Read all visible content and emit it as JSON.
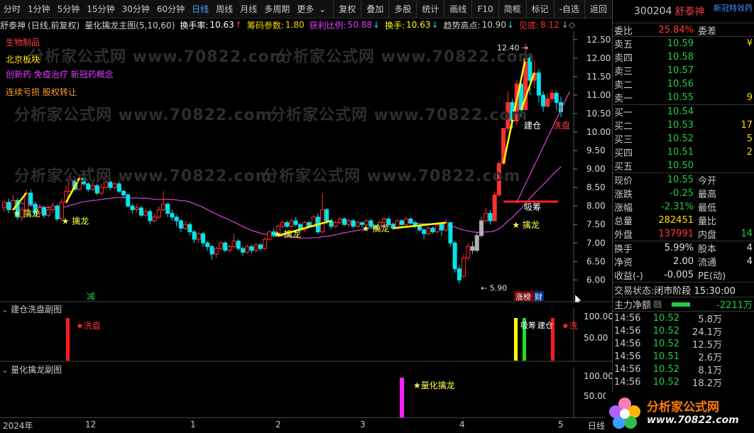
{
  "toolbar": {
    "periods": [
      "分时",
      "1分钟",
      "5分钟",
      "15分钟",
      "30分钟",
      "60分钟",
      "日线",
      "周线",
      "月线",
      "多周期",
      "更多"
    ],
    "active_period": "日线",
    "buttons": [
      "复权",
      "叠加",
      "多股",
      "统计",
      "画线",
      "F10",
      "简框",
      "标记",
      "-自选",
      "返回"
    ]
  },
  "info_line": {
    "stock": "舒泰神",
    "mode": "(日线,前复权)",
    "indicator": "量化擒龙主图(5,10,60)",
    "turnover_label": "换手率:",
    "turnover_value": "10.63",
    "chip_label": "筹码参数:",
    "chip_value": "1.80",
    "profit_label": "获利比例:",
    "profit_value": "50.88",
    "hand_label": "换手:",
    "hand_value": "10.63",
    "trend_label": "趋势高点:",
    "trend_value": "10.90",
    "bottom_label": "见底:",
    "bottom_value": "8.12"
  },
  "concepts": [
    {
      "text": "生物制品",
      "color": "#ff4040"
    },
    {
      "text": "北京板块",
      "color": "#ffe000"
    },
    {
      "text": "创新药 免疫治疗 新冠药概念",
      "color": "#e040ff"
    },
    {
      "text": "连续亏损 股权转让",
      "color": "#ff9a30"
    }
  ],
  "watermark": "分析家公式网 www.70822.com",
  "chart_data": {
    "type": "candlestick",
    "price_axis": [
      "12.50",
      "12.00",
      "11.50",
      "11.00",
      "10.50",
      "10.00",
      "9.50",
      "9.00",
      "8.50",
      "8.00",
      "7.50",
      "7.00",
      "6.50",
      "6.00"
    ],
    "ylim": [
      5.7,
      12.65
    ],
    "high_label": "12.40",
    "low_label": "5.90",
    "x_ticks": [
      "2024年",
      "12",
      "1",
      "2",
      "3",
      "4",
      "5"
    ],
    "period_label": "日线",
    "signals": [
      "★ 擒龙",
      "★ 擒龙",
      "★ 擒龙",
      "★ 擒龙",
      "★ 擒龙"
    ],
    "buy_label": "吸筹",
    "build_label": "建仓",
    "wash_label": "洗盘",
    "tag_minus": "减",
    "tag_limit": "涨榜",
    "tag_fin": "财",
    "series": [
      {
        "name": "candles",
        "values": [
          {
            "o": 7.95,
            "c": 8.1,
            "h": 8.18,
            "l": 7.85
          },
          {
            "o": 8.1,
            "c": 7.9,
            "h": 8.2,
            "l": 7.8
          },
          {
            "o": 7.9,
            "c": 8.15,
            "h": 8.3,
            "l": 7.85
          },
          {
            "o": 8.15,
            "c": 7.7,
            "h": 8.22,
            "l": 7.62
          },
          {
            "o": 7.7,
            "c": 7.9,
            "h": 7.98,
            "l": 7.6
          },
          {
            "o": 7.9,
            "c": 8.35,
            "h": 8.45,
            "l": 7.88
          },
          {
            "o": 8.35,
            "c": 8.05,
            "h": 8.45,
            "l": 7.98
          },
          {
            "o": 8.05,
            "c": 7.8,
            "h": 8.12,
            "l": 7.7
          },
          {
            "o": 7.8,
            "c": 7.95,
            "h": 8.05,
            "l": 7.75
          },
          {
            "o": 7.95,
            "c": 7.75,
            "h": 8.0,
            "l": 7.68
          },
          {
            "o": 7.75,
            "c": 7.9,
            "h": 8.0,
            "l": 7.7
          },
          {
            "o": 7.9,
            "c": 8.0,
            "h": 8.1,
            "l": 7.82
          },
          {
            "o": 8.0,
            "c": 7.65,
            "h": 8.05,
            "l": 7.6
          },
          {
            "o": 7.65,
            "c": 8.1,
            "h": 8.2,
            "l": 7.6
          },
          {
            "o": 8.1,
            "c": 8.4,
            "h": 8.55,
            "l": 8.05
          },
          {
            "o": 8.4,
            "c": 8.7,
            "h": 8.8,
            "l": 8.35
          },
          {
            "o": 8.7,
            "c": 8.45,
            "h": 8.78,
            "l": 8.4
          },
          {
            "o": 8.45,
            "c": 8.75,
            "h": 8.85,
            "l": 8.42
          },
          {
            "o": 8.75,
            "c": 8.6,
            "h": 8.95,
            "l": 8.55
          },
          {
            "o": 8.6,
            "c": 8.45,
            "h": 8.65,
            "l": 8.38
          },
          {
            "o": 8.45,
            "c": 8.55,
            "h": 8.62,
            "l": 8.4
          },
          {
            "o": 8.55,
            "c": 8.35,
            "h": 8.6,
            "l": 8.3
          },
          {
            "o": 8.35,
            "c": 8.5,
            "h": 8.6,
            "l": 8.3
          },
          {
            "o": 8.5,
            "c": 8.65,
            "h": 8.72,
            "l": 8.45
          },
          {
            "o": 8.65,
            "c": 8.5,
            "h": 8.7,
            "l": 8.42
          },
          {
            "o": 8.5,
            "c": 8.6,
            "h": 8.65,
            "l": 8.45
          },
          {
            "o": 8.6,
            "c": 8.4,
            "h": 8.65,
            "l": 8.35
          },
          {
            "o": 8.4,
            "c": 8.3,
            "h": 8.45,
            "l": 8.2
          },
          {
            "o": 8.3,
            "c": 8.0,
            "h": 8.35,
            "l": 7.95
          },
          {
            "o": 8.0,
            "c": 7.9,
            "h": 8.05,
            "l": 7.8
          },
          {
            "o": 7.9,
            "c": 7.95,
            "h": 8.05,
            "l": 7.82
          },
          {
            "o": 7.95,
            "c": 7.75,
            "h": 8.0,
            "l": 7.7
          },
          {
            "o": 7.75,
            "c": 7.85,
            "h": 7.95,
            "l": 7.7
          },
          {
            "o": 7.85,
            "c": 7.6,
            "h": 7.9,
            "l": 7.5
          },
          {
            "o": 7.6,
            "c": 7.7,
            "h": 7.8,
            "l": 7.55
          },
          {
            "o": 7.7,
            "c": 7.9,
            "h": 8.0,
            "l": 7.65
          },
          {
            "o": 7.9,
            "c": 8.05,
            "h": 8.4,
            "l": 7.85
          },
          {
            "o": 8.05,
            "c": 7.8,
            "h": 8.1,
            "l": 7.7
          },
          {
            "o": 7.8,
            "c": 7.7,
            "h": 7.9,
            "l": 7.6
          },
          {
            "o": 7.7,
            "c": 7.6,
            "h": 7.75,
            "l": 7.45
          },
          {
            "o": 7.6,
            "c": 7.4,
            "h": 7.65,
            "l": 7.3
          },
          {
            "o": 7.4,
            "c": 7.5,
            "h": 7.6,
            "l": 7.35
          },
          {
            "o": 7.5,
            "c": 7.3,
            "h": 7.55,
            "l": 7.2
          },
          {
            "o": 7.3,
            "c": 7.1,
            "h": 7.35,
            "l": 7.0
          },
          {
            "o": 7.1,
            "c": 7.25,
            "h": 7.3,
            "l": 7.0
          },
          {
            "o": 7.25,
            "c": 7.0,
            "h": 7.3,
            "l": 6.9
          },
          {
            "o": 7.0,
            "c": 6.9,
            "h": 7.05,
            "l": 6.8
          },
          {
            "o": 6.9,
            "c": 6.7,
            "h": 6.95,
            "l": 6.55
          },
          {
            "o": 6.7,
            "c": 6.85,
            "h": 6.9,
            "l": 6.6
          },
          {
            "o": 6.85,
            "c": 7.0,
            "h": 7.05,
            "l": 6.8
          },
          {
            "o": 7.0,
            "c": 6.8,
            "h": 7.05,
            "l": 6.75
          },
          {
            "o": 6.8,
            "c": 6.9,
            "h": 6.95,
            "l": 6.75
          },
          {
            "o": 6.9,
            "c": 7.05,
            "h": 7.25,
            "l": 6.85
          },
          {
            "o": 7.05,
            "c": 6.85,
            "h": 7.1,
            "l": 6.8
          },
          {
            "o": 6.85,
            "c": 6.75,
            "h": 6.9,
            "l": 6.65
          },
          {
            "o": 6.75,
            "c": 6.9,
            "h": 6.95,
            "l": 6.7
          },
          {
            "o": 6.9,
            "c": 6.8,
            "h": 6.95,
            "l": 6.72
          },
          {
            "o": 6.8,
            "c": 6.95,
            "h": 7.0,
            "l": 6.75
          },
          {
            "o": 6.95,
            "c": 6.85,
            "h": 7.0,
            "l": 6.8
          },
          {
            "o": 6.85,
            "c": 7.1,
            "h": 7.15,
            "l": 6.82
          },
          {
            "o": 7.1,
            "c": 7.3,
            "h": 7.35,
            "l": 7.05
          },
          {
            "o": 7.3,
            "c": 7.2,
            "h": 7.4,
            "l": 7.15
          },
          {
            "o": 7.2,
            "c": 7.45,
            "h": 7.5,
            "l": 7.15
          },
          {
            "o": 7.45,
            "c": 7.55,
            "h": 7.6,
            "l": 7.4
          },
          {
            "o": 7.55,
            "c": 7.45,
            "h": 7.6,
            "l": 7.4
          },
          {
            "o": 7.45,
            "c": 7.6,
            "h": 7.65,
            "l": 7.4
          },
          {
            "o": 7.6,
            "c": 7.5,
            "h": 7.7,
            "l": 7.45
          },
          {
            "o": 7.5,
            "c": 7.35,
            "h": 7.55,
            "l": 7.3
          },
          {
            "o": 7.35,
            "c": 7.55,
            "h": 7.6,
            "l": 7.3
          },
          {
            "o": 7.55,
            "c": 7.45,
            "h": 7.6,
            "l": 7.4
          },
          {
            "o": 7.45,
            "c": 7.7,
            "h": 7.75,
            "l": 7.4
          },
          {
            "o": 7.7,
            "c": 7.3,
            "h": 7.8,
            "l": 7.25
          },
          {
            "o": 7.3,
            "c": 7.9,
            "h": 8.35,
            "l": 7.25
          },
          {
            "o": 7.9,
            "c": 7.6,
            "h": 7.95,
            "l": 7.5
          },
          {
            "o": 7.6,
            "c": 7.45,
            "h": 7.65,
            "l": 7.38
          },
          {
            "o": 7.45,
            "c": 7.55,
            "h": 7.6,
            "l": 7.4
          },
          {
            "o": 7.55,
            "c": 7.65,
            "h": 7.7,
            "l": 7.5
          },
          {
            "o": 7.65,
            "c": 7.5,
            "h": 7.7,
            "l": 7.45
          },
          {
            "o": 7.5,
            "c": 7.6,
            "h": 7.65,
            "l": 7.42
          },
          {
            "o": 7.6,
            "c": 7.45,
            "h": 7.65,
            "l": 7.4
          },
          {
            "o": 7.45,
            "c": 7.55,
            "h": 7.6,
            "l": 7.4
          },
          {
            "o": 7.55,
            "c": 7.5,
            "h": 7.58,
            "l": 7.42
          },
          {
            "o": 7.5,
            "c": 7.6,
            "h": 7.65,
            "l": 7.45
          },
          {
            "o": 7.6,
            "c": 7.45,
            "h": 7.65,
            "l": 7.4
          },
          {
            "o": 7.45,
            "c": 7.4,
            "h": 7.5,
            "l": 7.35
          },
          {
            "o": 7.4,
            "c": 7.55,
            "h": 7.6,
            "l": 7.35
          },
          {
            "o": 7.55,
            "c": 7.65,
            "h": 7.7,
            "l": 7.5
          },
          {
            "o": 7.65,
            "c": 7.5,
            "h": 7.7,
            "l": 7.45
          },
          {
            "o": 7.5,
            "c": 7.4,
            "h": 7.55,
            "l": 7.35
          },
          {
            "o": 7.4,
            "c": 7.6,
            "h": 7.65,
            "l": 7.35
          },
          {
            "o": 7.6,
            "c": 7.5,
            "h": 7.65,
            "l": 7.45
          },
          {
            "o": 7.5,
            "c": 7.65,
            "h": 7.7,
            "l": 7.45
          },
          {
            "o": 7.65,
            "c": 7.55,
            "h": 7.7,
            "l": 7.5
          },
          {
            "o": 7.55,
            "c": 7.45,
            "h": 7.6,
            "l": 7.4
          },
          {
            "o": 7.45,
            "c": 7.35,
            "h": 7.5,
            "l": 7.3
          },
          {
            "o": 7.35,
            "c": 7.25,
            "h": 7.4,
            "l": 7.1
          },
          {
            "o": 7.25,
            "c": 7.4,
            "h": 7.45,
            "l": 7.2
          },
          {
            "o": 7.4,
            "c": 7.3,
            "h": 7.45,
            "l": 7.25
          },
          {
            "o": 7.3,
            "c": 7.5,
            "h": 7.55,
            "l": 7.25
          },
          {
            "o": 7.5,
            "c": 7.35,
            "h": 7.55,
            "l": 7.2
          },
          {
            "o": 7.35,
            "c": 7.55,
            "h": 7.65,
            "l": 7.3
          },
          {
            "o": 7.55,
            "c": 7.0,
            "h": 7.05,
            "l": 6.9
          },
          {
            "o": 7.0,
            "c": 6.3,
            "h": 7.05,
            "l": 6.2
          },
          {
            "o": 6.3,
            "c": 6.0,
            "h": 6.4,
            "l": 5.9
          },
          {
            "o": 6.1,
            "c": 6.6,
            "h": 6.7,
            "l": 6.05
          },
          {
            "o": 6.6,
            "c": 6.9,
            "h": 7.0,
            "l": 6.55
          },
          {
            "o": 6.9,
            "c": 6.8,
            "h": 7.05,
            "l": 6.7
          },
          {
            "o": 6.8,
            "c": 7.2,
            "h": 7.3,
            "l": 6.75
          },
          {
            "o": 7.2,
            "c": 7.6,
            "h": 7.7,
            "l": 7.15
          },
          {
            "o": 7.6,
            "c": 7.8,
            "h": 7.95,
            "l": 7.55
          },
          {
            "o": 7.8,
            "c": 7.6,
            "h": 7.9,
            "l": 7.5
          },
          {
            "o": 7.6,
            "c": 8.3,
            "h": 8.4,
            "l": 7.58
          },
          {
            "o": 8.3,
            "c": 9.15,
            "h": 9.2,
            "l": 8.25
          },
          {
            "o": 9.15,
            "c": 10.1,
            "h": 10.1,
            "l": 9.1
          },
          {
            "o": 10.1,
            "c": 10.8,
            "h": 11.1,
            "l": 10.0
          },
          {
            "o": 10.8,
            "c": 10.3,
            "h": 10.9,
            "l": 10.1
          },
          {
            "o": 10.3,
            "c": 11.3,
            "h": 11.4,
            "l": 10.2
          },
          {
            "o": 11.3,
            "c": 10.6,
            "h": 11.4,
            "l": 10.4
          },
          {
            "o": 10.6,
            "c": 12.0,
            "h": 12.4,
            "l": 10.6
          },
          {
            "o": 12.0,
            "c": 11.4,
            "h": 12.1,
            "l": 11.0
          },
          {
            "o": 11.4,
            "c": 11.6,
            "h": 11.95,
            "l": 11.2
          },
          {
            "o": 11.6,
            "c": 11.0,
            "h": 11.7,
            "l": 10.8
          },
          {
            "o": 11.0,
            "c": 10.7,
            "h": 11.1,
            "l": 10.55
          },
          {
            "o": 10.7,
            "c": 10.9,
            "h": 11.05,
            "l": 10.65
          },
          {
            "o": 10.9,
            "c": 11.05,
            "h": 11.15,
            "l": 10.8
          },
          {
            "o": 11.05,
            "c": 10.8,
            "h": 11.1,
            "l": 10.6
          },
          {
            "o": 10.8,
            "c": 10.55,
            "h": 10.95,
            "l": 10.4
          }
        ]
      }
    ]
  },
  "sub1": {
    "title": "建仓洗盘副图",
    "axis": [
      "100.00",
      "50.00"
    ],
    "wash": "★洗盘",
    "buy": "吸筹",
    "build": "建仓",
    "wash2": "★洗"
  },
  "sub2": {
    "title": "量化擒龙副图",
    "axis": [
      "100.00",
      "50.00"
    ],
    "label": "★量化擒龙"
  },
  "side": {
    "code": "300204",
    "name": "舒泰神",
    "promo": "新冠特效药",
    "ratio_label": "委比",
    "ratio_value": "25.84%",
    "diff_label": "委差",
    "asks": [
      {
        "label": "卖五",
        "price": "10.59",
        "vol": "¥"
      },
      {
        "label": "卖四",
        "price": "10.58",
        "vol": ""
      },
      {
        "label": "卖三",
        "price": "10.57",
        "vol": ""
      },
      {
        "label": "卖二",
        "price": "10.56",
        "vol": ""
      },
      {
        "label": "卖一",
        "price": "10.55",
        "vol": "9"
      }
    ],
    "bids": [
      {
        "label": "买一",
        "price": "10.54",
        "vol": ""
      },
      {
        "label": "买二",
        "price": "10.53",
        "vol": "17"
      },
      {
        "label": "买三",
        "price": "10.52",
        "vol": "5"
      },
      {
        "label": "买四",
        "price": "10.51",
        "vol": "2"
      },
      {
        "label": "买五",
        "price": "10.50",
        "vol": ""
      }
    ],
    "quote": [
      {
        "l1": "现价",
        "v1": "10.55",
        "l2": "今开",
        "v2": "",
        "c": "green"
      },
      {
        "l1": "涨跌",
        "v1": "-0.25",
        "l2": "最高",
        "v2": "",
        "c": "green"
      },
      {
        "l1": "涨幅",
        "v1": "-2.31%",
        "l2": "最低",
        "v2": "",
        "c": "green"
      },
      {
        "l1": "总量",
        "v1": "282451",
        "l2": "量比",
        "v2": "",
        "c": "yellow"
      },
      {
        "l1": "外盘",
        "v1": "137991",
        "l2": "内盘",
        "v2": "14",
        "c": "red"
      }
    ],
    "stats": [
      {
        "l1": "换手",
        "v1": "5.99%",
        "l2": "股本",
        "v2": "4"
      },
      {
        "l1": "净资",
        "v1": "2.00",
        "l2": "流通",
        "v2": "4"
      },
      {
        "l1": "收益(-)",
        "v1": "-0.005",
        "l2": "PE(动)",
        "v2": ""
      }
    ],
    "status_label": "交易状态:",
    "status_value": "闭市阶段 15:30:00",
    "flow_label": "主力净额",
    "flow_value": "-2211万",
    "ticks": [
      {
        "t": "14:56",
        "p": "10.52",
        "v": "5.8万",
        "c": "red"
      },
      {
        "t": "14:56",
        "p": "10.52",
        "v": "24.1万",
        "c": "red"
      },
      {
        "t": "14:56",
        "p": "10.52",
        "v": "12.5万",
        "c": "red"
      },
      {
        "t": "14:56",
        "p": "10.51",
        "v": "2.6万",
        "c": "red"
      },
      {
        "t": "14:56",
        "p": "10.52",
        "v": "8.1万",
        "c": "red"
      },
      {
        "t": "14:56",
        "p": "10.52",
        "v": "18.2万",
        "c": "red"
      }
    ]
  },
  "logo": {
    "brand": "分析家公式网",
    "url": "www.70822.com"
  },
  "colors": {
    "up": "#ff3030",
    "down": "#00e5ee",
    "ma60": "#e040e0",
    "signal_yellow": "#ffff00",
    "accent_blue": "#4fa0ff"
  }
}
